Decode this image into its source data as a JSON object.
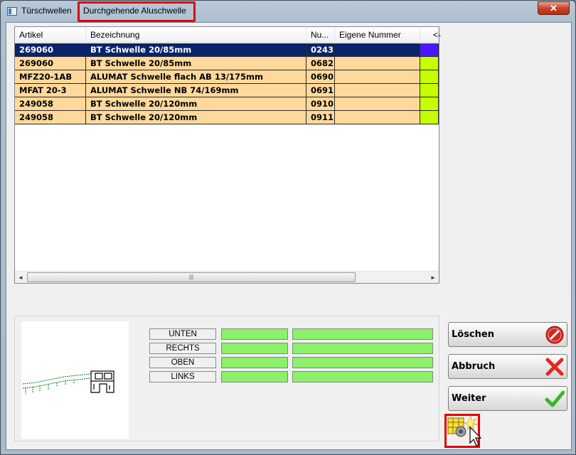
{
  "window": {
    "title_parts": [
      "Türschwellen",
      "Durchgehende Aluschwelle"
    ],
    "close_label": "✕"
  },
  "grid": {
    "columns": [
      "Artikel",
      "Bezeichnung",
      "Nu...",
      "Eigene Nummer",
      "<-"
    ],
    "rows": [
      {
        "artikel": "269060",
        "bezeichnung": "BT Schwelle 20/85mm",
        "nummer": "0243",
        "eigene": "",
        "color": "#4a17ff",
        "selected": true
      },
      {
        "artikel": "269060",
        "bezeichnung": "BT Schwelle 20/85mm",
        "nummer": "0682",
        "eigene": "",
        "color": "#c5ff00",
        "selected": false
      },
      {
        "artikel": "MFZ20-1AB",
        "bezeichnung": "ALUMAT Schwelle flach AB 13/175mm",
        "nummer": "0690",
        "eigene": "",
        "color": "#c5ff00",
        "selected": false
      },
      {
        "artikel": "MFAT 20-3",
        "bezeichnung": "ALUMAT Schwelle NB 74/169mm",
        "nummer": "0691",
        "eigene": "",
        "color": "#c5ff00",
        "selected": false
      },
      {
        "artikel": "249058",
        "bezeichnung": "BT Schwelle 20/120mm",
        "nummer": "0910",
        "eigene": "",
        "color": "#c5ff00",
        "selected": false
      },
      {
        "artikel": "249058",
        "bezeichnung": "BT Schwelle 20/120mm",
        "nummer": "0911",
        "eigene": "",
        "color": "#c5ff00",
        "selected": false
      }
    ],
    "scroll_left": "◄",
    "scroll_right": "►",
    "scroll_grip": "|||"
  },
  "directions": [
    "UNTEN",
    "RECHTS",
    "OBEN",
    "LINKS"
  ],
  "buttons": {
    "delete_label": "Löschen",
    "cancel_label": "Abbruch",
    "next_label": "Weiter"
  },
  "icons": {
    "delete": "delete-icon",
    "cancel": "cancel-icon",
    "next": "checkmark-icon",
    "tool": "profile-tool-icon"
  },
  "colors": {
    "row_bg": "#ffd99b",
    "row_selected": "#0a246a",
    "status_green": "#8df06a",
    "highlight_red": "#e00000"
  }
}
